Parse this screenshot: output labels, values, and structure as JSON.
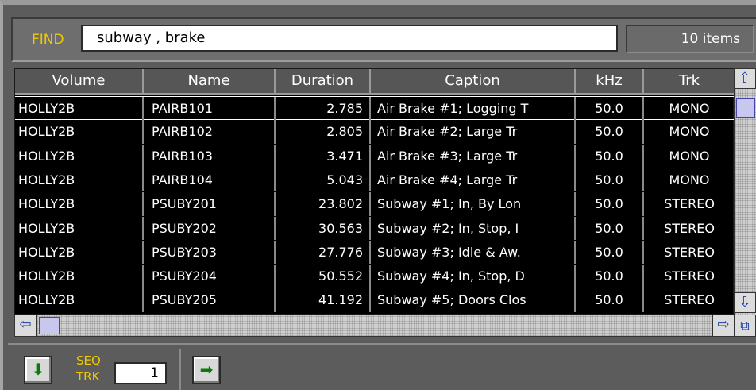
{
  "find": {
    "label": "FIND",
    "query": "subway , brake",
    "count": "10 items"
  },
  "table": {
    "columns": [
      "Volume",
      "Name",
      "Duration",
      "Caption",
      "kHz",
      "Trk"
    ],
    "rows": [
      {
        "volume": "HOLLY2B",
        "name": "PAIRB101",
        "duration": "2.785",
        "caption": "Air Brake #1; Logging T",
        "khz": "50.0",
        "trk": "MONO",
        "selected": true
      },
      {
        "volume": "HOLLY2B",
        "name": "PAIRB102",
        "duration": "2.805",
        "caption": "Air Brake #2; Large Tr",
        "khz": "50.0",
        "trk": "MONO"
      },
      {
        "volume": "HOLLY2B",
        "name": "PAIRB103",
        "duration": "3.471",
        "caption": "Air Brake #3; Large Tr",
        "khz": "50.0",
        "trk": "MONO"
      },
      {
        "volume": "HOLLY2B",
        "name": "PAIRB104",
        "duration": "5.043",
        "caption": "Air Brake #4; Large Tr",
        "khz": "50.0",
        "trk": "MONO"
      },
      {
        "volume": "HOLLY2B",
        "name": "PSUBY201",
        "duration": "23.802",
        "caption": "Subway #1; In, By Lon",
        "khz": "50.0",
        "trk": "STEREO"
      },
      {
        "volume": "HOLLY2B",
        "name": "PSUBY202",
        "duration": "30.563",
        "caption": "Subway #2; In, Stop, I",
        "khz": "50.0",
        "trk": "STEREO"
      },
      {
        "volume": "HOLLY2B",
        "name": "PSUBY203",
        "duration": "27.776",
        "caption": "Subway #3; Idle & Aw.",
        "khz": "50.0",
        "trk": "STEREO"
      },
      {
        "volume": "HOLLY2B",
        "name": "PSUBY204",
        "duration": "50.552",
        "caption": "Subway #4; In, Stop, D",
        "khz": "50.0",
        "trk": "STEREO"
      },
      {
        "volume": "HOLLY2B",
        "name": "PSUBY205",
        "duration": "41.192",
        "caption": "Subway #5; Doors Clos",
        "khz": "50.0",
        "trk": "STEREO"
      }
    ]
  },
  "seq": {
    "label_line1": "SEQ",
    "label_line2": "TRK",
    "value": "1"
  },
  "icons": {
    "down": "down-arrow-icon",
    "right": "right-arrow-icon"
  },
  "colors": {
    "label_yellow": "#f0c800",
    "arrow_green": "#0a7a0a",
    "scroll_blue": "#1a3aa0"
  }
}
